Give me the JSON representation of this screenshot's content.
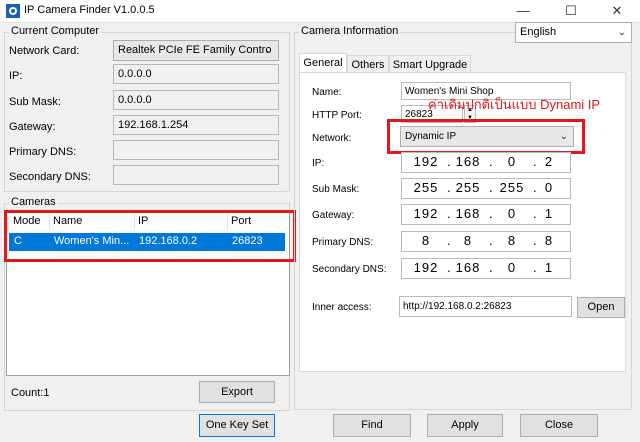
{
  "window": {
    "title": "IP Camera Finder V1.0.0.5",
    "minimize": "—",
    "maximize": "☐",
    "close": "✕"
  },
  "language": {
    "selected": "English"
  },
  "current_computer": {
    "legend": "Current Computer",
    "network_card_label": "Network Card:",
    "network_card_value": "Realtek PCIe FE Family Contro",
    "ip_label": "IP:",
    "ip_value": "0.0.0.0",
    "submask_label": "Sub Mask:",
    "submask_value": "0.0.0.0",
    "gateway_label": "Gateway:",
    "gateway_value": "192.168.1.254",
    "primary_dns_label": "Primary DNS:",
    "primary_dns_value": "",
    "secondary_dns_label": "Secondary DNS:",
    "secondary_dns_value": ""
  },
  "cameras": {
    "legend": "Cameras",
    "columns": [
      "Mode",
      "Name",
      "IP",
      "Port"
    ],
    "rows": [
      {
        "mode": "C",
        "name": "Women's Min...",
        "ip": "192.168.0.2",
        "port": "26823"
      }
    ],
    "count_label": "Count:1",
    "export_label": "Export"
  },
  "camera_info": {
    "legend": "Camera Information",
    "tabs": [
      "General",
      "Others",
      "Smart Upgrade"
    ],
    "name_label": "Name:",
    "name_value": "Women's Mini Shop",
    "http_port_label": "HTTP Port:",
    "http_port_value": "26823",
    "network_label": "Network:",
    "network_value": "Dynamic IP",
    "ip_label": "IP:",
    "ip": [
      "192",
      "168",
      "0",
      "2"
    ],
    "submask_label": "Sub Mask:",
    "submask": [
      "255",
      "255",
      "255",
      "0"
    ],
    "gateway_label": "Gateway:",
    "gateway": [
      "192",
      "168",
      "0",
      "1"
    ],
    "primary_dns_label": "Primary DNS:",
    "primary_dns": [
      "8",
      "8",
      "8",
      "8"
    ],
    "secondary_dns_label": "Secondary DNS:",
    "secondary_dns": [
      "192",
      "168",
      "0",
      "1"
    ],
    "inner_access_label": "Inner access:",
    "inner_access_value": "http://192.168.0.2:26823",
    "open_label": "Open"
  },
  "annotation": {
    "text": "ค่าเดิมปกติเป็นแบบ Dynami IP",
    "color": "#e31919"
  },
  "footer": {
    "one_key_set": "One Key Set",
    "find": "Find",
    "apply": "Apply",
    "close": "Close"
  },
  "colors": {
    "selection": "#0078d7",
    "highlight_box": "#e31919"
  }
}
